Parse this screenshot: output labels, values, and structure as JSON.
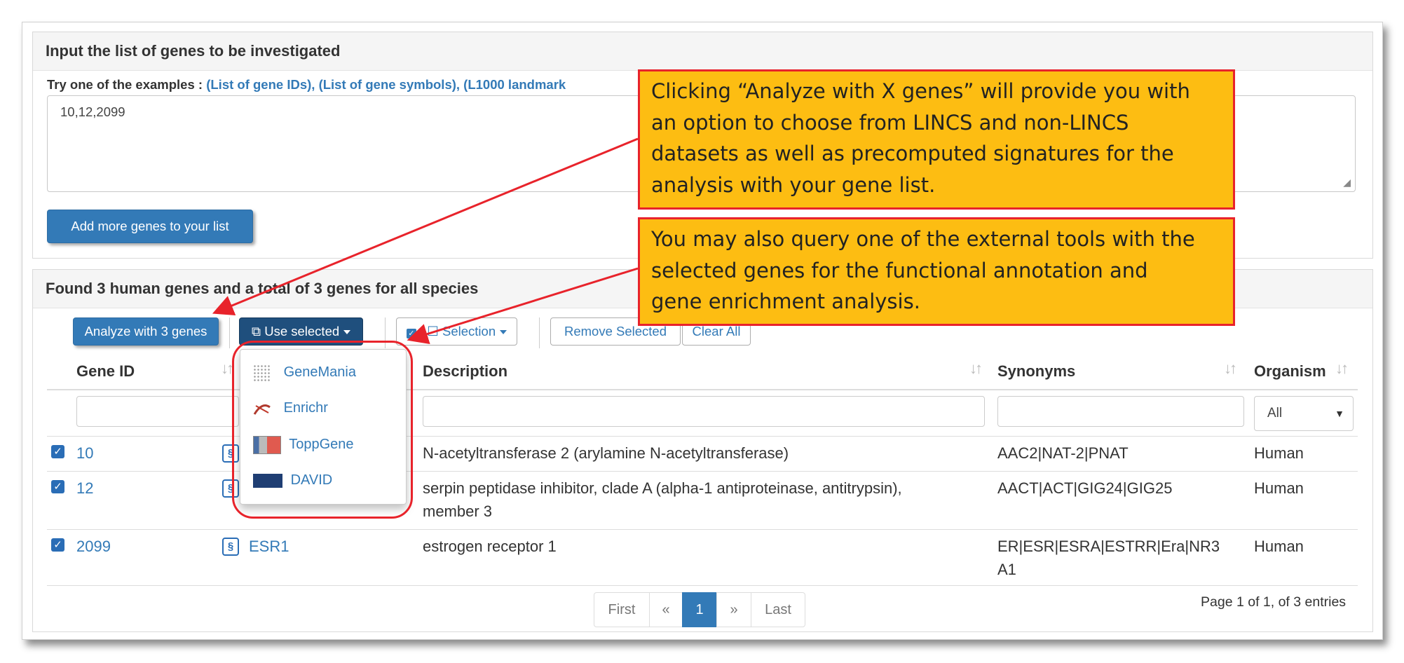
{
  "input_panel": {
    "title": "Input the list of genes to be investigated",
    "examples_prefix": "Try one of the examples :",
    "example_links": [
      "(List of gene IDs),",
      "(List of gene symbols),",
      "(L1000 landmark"
    ],
    "textarea_value": "10,12,2099",
    "add_more_button": "Add more genes to your list"
  },
  "results_panel": {
    "title": "Found 3 human genes and a total of 3 genes for all species",
    "toolbar": {
      "analyze_button": "Analyze with 3 genes",
      "use_selected_button": "Use selected",
      "selection_button": "/ ☐ Selection",
      "remove_selected_button": "Remove Selected",
      "clear_all_button": "Clear All"
    },
    "columns": [
      "Gene ID",
      "Description",
      "Synonyms",
      "Organism"
    ],
    "organism_filter": {
      "selected": "All"
    },
    "rows": [
      {
        "gene_id": "10",
        "symbol": "",
        "description": "N-acetyltransferase 2 (arylamine N-acetyltransferase)",
        "description_line2": "",
        "synonyms": "AAC2|NAT-2|PNAT",
        "synonyms_line2": "",
        "organism": "Human"
      },
      {
        "gene_id": "12",
        "symbol": "",
        "description": "serpin peptidase inhibitor, clade A (alpha-1 antiproteinase, antitrypsin),",
        "description_line2": "member 3",
        "synonyms": "AACT|ACT|GIG24|GIG25",
        "synonyms_line2": "",
        "organism": "Human"
      },
      {
        "gene_id": "2099",
        "symbol": "ESR1",
        "description": "estrogen receptor 1",
        "description_line2": "",
        "synonyms": "ER|ESR|ESRA|ESTRR|Era|NR3",
        "synonyms_line2": "A1",
        "organism": "Human"
      }
    ],
    "dropdown_items": [
      {
        "label": "GeneMania",
        "icon": "genemania-icon"
      },
      {
        "label": "Enrichr",
        "icon": "enrichr-icon"
      },
      {
        "label": "ToppGene",
        "icon": "toppgene-icon"
      },
      {
        "label": "DAVID",
        "icon": "david-icon"
      }
    ],
    "pagination": {
      "first": "First",
      "prev": "«",
      "current": "1",
      "next": "»",
      "last": "Last"
    },
    "page_info": "Page 1 of 1, of 3 entries"
  },
  "callouts": {
    "analyze": [
      "Clicking “Analyze with X genes” will provide you with",
      "an option to choose from LINCS and non-LINCS",
      "datasets as well as precomputed signatures for the",
      "analysis with your gene list."
    ],
    "external": [
      "You may also query one of the external tools with the",
      "selected genes for the functional annotation and",
      "gene enrichment analysis."
    ]
  },
  "colors": {
    "callout_fill": "#fdbd12",
    "annotation_red": "#e8232b",
    "primary": "#337ab7"
  }
}
